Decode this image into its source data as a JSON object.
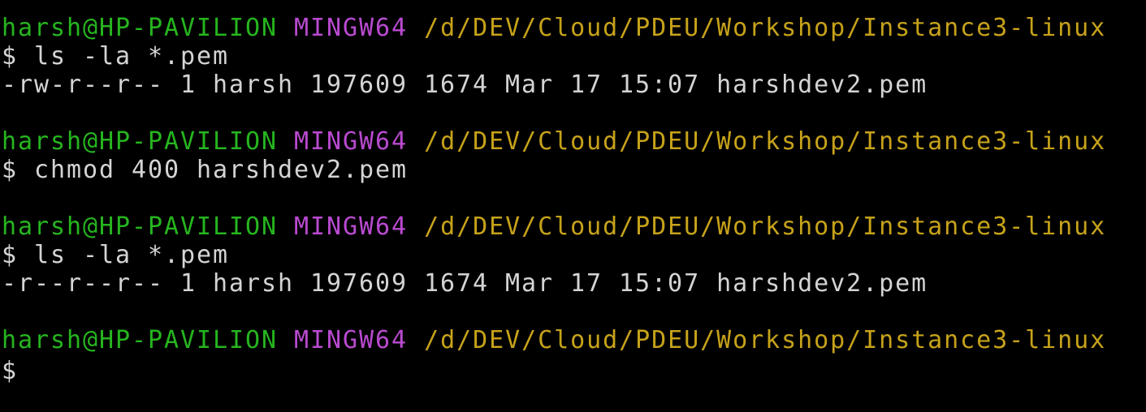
{
  "terminal": {
    "blocks": [
      {
        "prompt": {
          "user_host": "harsh@HP-PAVILION",
          "system": "MINGW64",
          "path": "/d/DEV/Cloud/PDEU/Workshop/Instance3-linux"
        },
        "command": "$ ls -la *.pem",
        "output": "-rw-r--r-- 1 harsh 197609 1674 Mar 17 15:07 harshdev2.pem"
      },
      {
        "prompt": {
          "user_host": "harsh@HP-PAVILION",
          "system": "MINGW64",
          "path": "/d/DEV/Cloud/PDEU/Workshop/Instance3-linux"
        },
        "command": "$ chmod 400 harshdev2.pem"
      },
      {
        "prompt": {
          "user_host": "harsh@HP-PAVILION",
          "system": "MINGW64",
          "path": "/d/DEV/Cloud/PDEU/Workshop/Instance3-linux"
        },
        "command": "$ ls -la *.pem",
        "output": "-r--r--r-- 1 harsh 197609 1674 Mar 17 15:07 harshdev2.pem"
      },
      {
        "prompt": {
          "user_host": "harsh@HP-PAVILION",
          "system": "MINGW64",
          "path": "/d/DEV/Cloud/PDEU/Workshop/Instance3-linux"
        },
        "command": "$"
      }
    ],
    "colors": {
      "background": "#000000",
      "user_host": "#26b51f",
      "system": "#b94ad0",
      "path": "#c6a21a",
      "text": "#d4d4d4"
    }
  }
}
